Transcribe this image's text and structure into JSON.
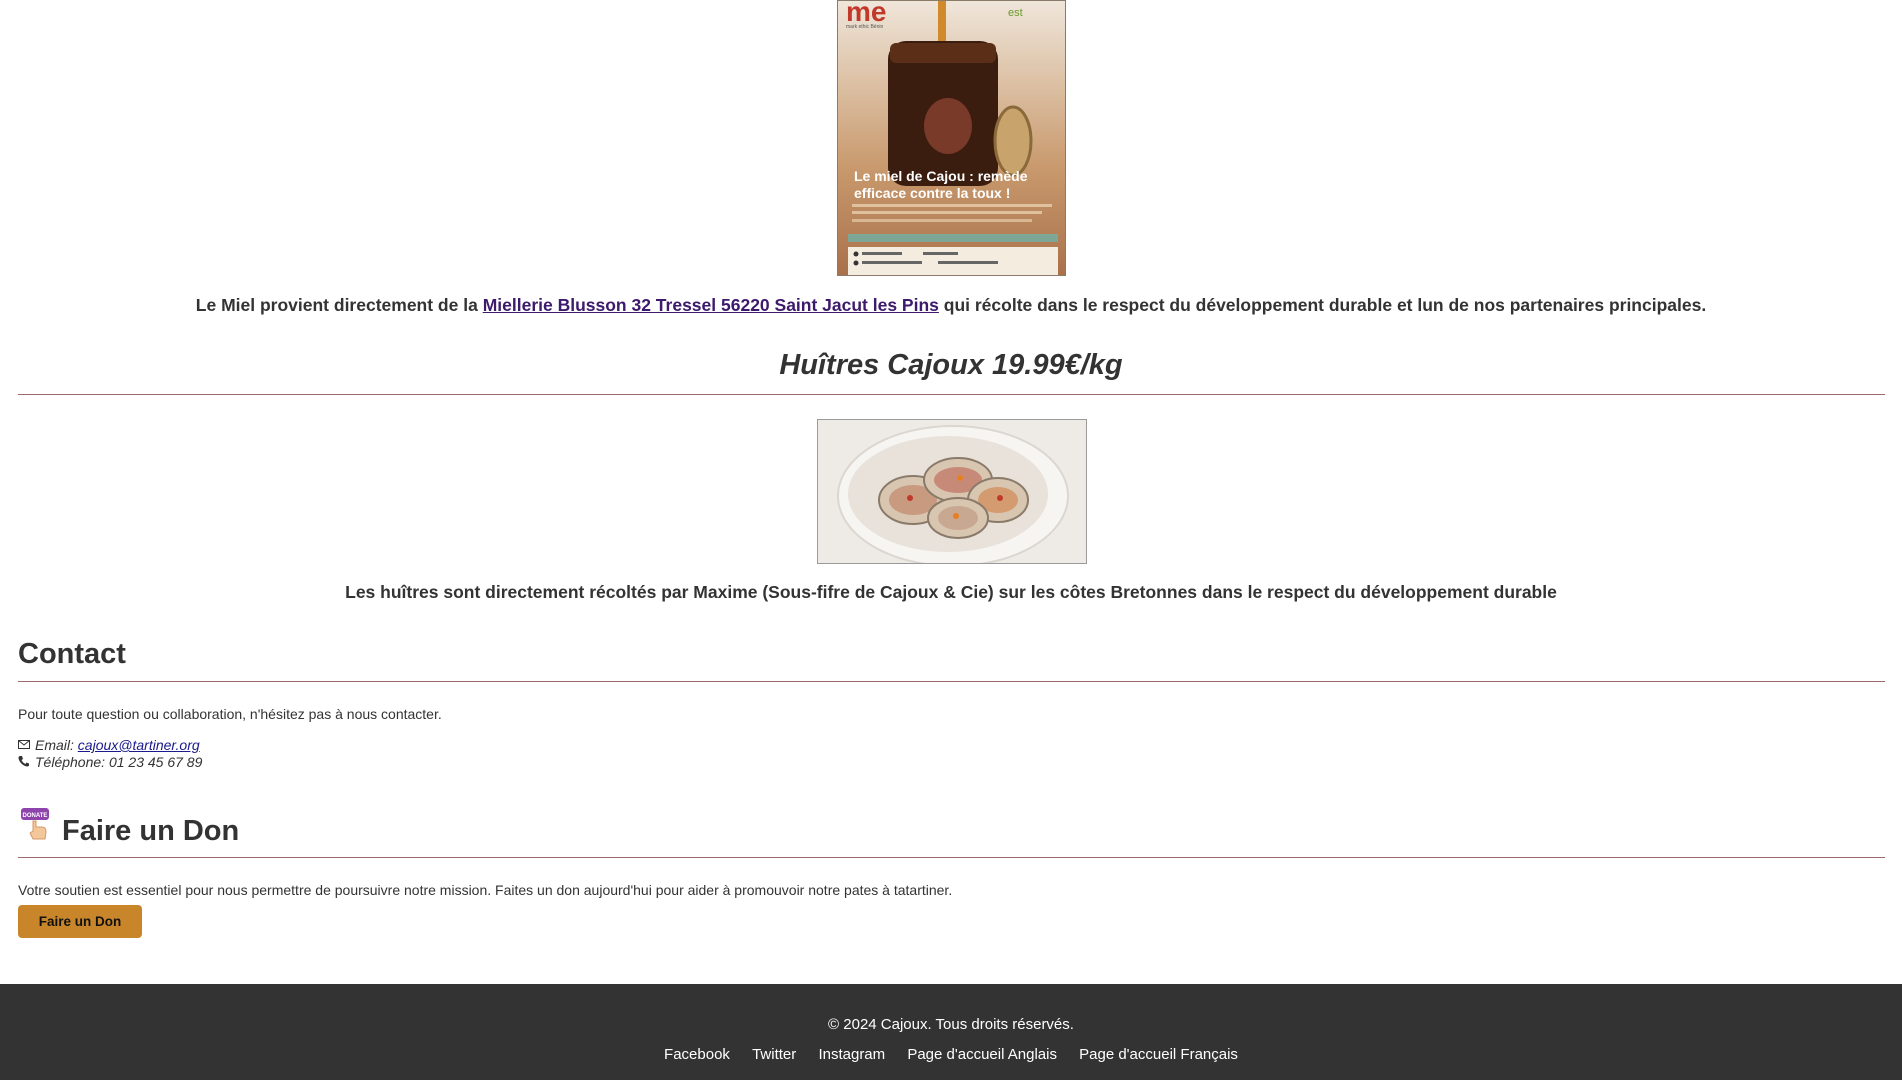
{
  "honey": {
    "poster": {
      "logo": "me",
      "brand_small": "mark ethic Bénin",
      "partner_logo": "est",
      "headline_line1": "Le miel de Cajou : remède",
      "headline_line2": "efficace contre la toux !"
    },
    "caption_before": "Le Miel provient directement de la ",
    "caption_link": "Miellerie Blusson 32 Tressel 56220 Saint Jacut les Pins",
    "caption_after": " qui récolte dans le respect du développement durable et lun de nos partenaires principales."
  },
  "oysters": {
    "title": "Huîtres Cajoux 19.99€/kg",
    "caption": "Les huîtres sont directement récoltés par Maxime (Sous-fifre de Cajoux & Cie) sur les côtes Bretonnes dans le respect du développement durable"
  },
  "contact": {
    "heading": "Contact",
    "intro": "Pour toute question ou collaboration, n'hésitez pas à nous contacter.",
    "email_label": "Email: ",
    "email": "cajoux@tartiner.org",
    "phone": "Téléphone: 01 23 45 67 89",
    "email_icon": "envelope-icon",
    "phone_icon": "phone-icon"
  },
  "donate": {
    "heading": "Faire un Don",
    "icon_text": "DONATE",
    "text": "Votre soutien est essentiel pour nous permettre de poursuivre notre mission. Faites un don aujourd'hui pour aider à promouvoir notre pates à tatartiner.",
    "button_label": "Faire un Don",
    "button_color": "#c8852a"
  },
  "footer": {
    "copyright": "© 2024 Cajoux. Tous droits réservés.",
    "links": [
      "Facebook",
      "Twitter",
      "Instagram",
      "Page d'accueil Anglais",
      "Page d'accueil Français"
    ],
    "background": "#333333"
  }
}
